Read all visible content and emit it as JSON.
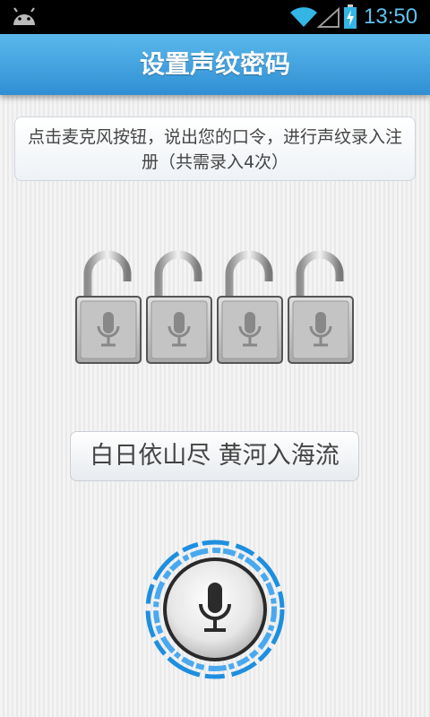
{
  "status_bar": {
    "time": "13:50",
    "icons": [
      "android-icon",
      "wifi-icon",
      "signal-icon",
      "battery-charging-icon"
    ]
  },
  "header": {
    "title": "设置声纹密码"
  },
  "instruction": {
    "text": "点击麦克风按钮，说出您的口令，进行声纹录入注册（共需录入4次）"
  },
  "locks": {
    "count": 4,
    "unlocked": 4,
    "icon": "microphone-icon"
  },
  "phrase": {
    "text": "白日依山尽 黄河入海流"
  },
  "record_button": {
    "icon": "microphone-icon",
    "accent_color": "#1e8fe0"
  },
  "colors": {
    "title_bar": "#3a9fe0",
    "clock": "#5dc1f0",
    "accent": "#1e8fe0"
  }
}
